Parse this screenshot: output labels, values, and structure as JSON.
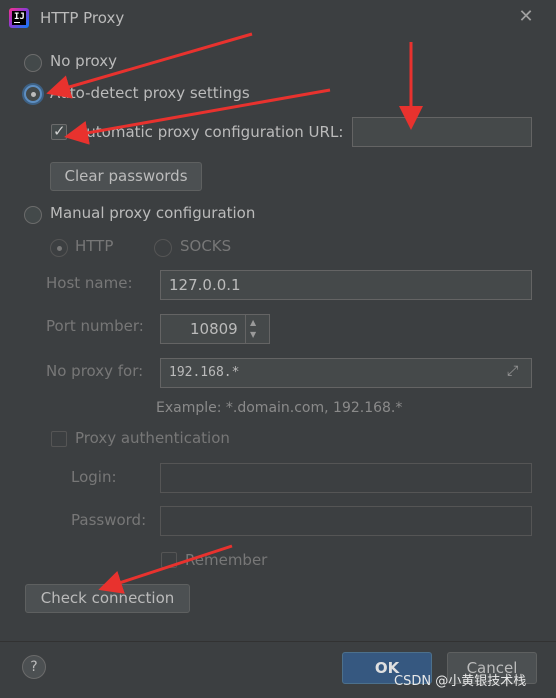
{
  "window": {
    "title": "HTTP Proxy",
    "icon": "intellij-idea-icon"
  },
  "options": {
    "no_proxy": "No proxy",
    "auto_detect": "Auto-detect proxy settings",
    "auto_config_url": "Automatic proxy configuration URL:",
    "auto_config_url_value": "",
    "clear_passwords": "Clear passwords",
    "manual": "Manual proxy configuration"
  },
  "manual": {
    "http": "HTTP",
    "socks": "SOCKS",
    "host_label": "Host name:",
    "host_value": "127.0.0.1",
    "port_label": "Port number:",
    "port_value": "10809",
    "noproxy_label": "No proxy for:",
    "noproxy_value": "192.168.*",
    "example": "Example: *.domain.com, 192.168.*",
    "auth": "Proxy authentication",
    "login_label": "Login:",
    "login_value": "",
    "password_label": "Password:",
    "password_value": "",
    "remember": "Remember"
  },
  "buttons": {
    "check_connection": "Check connection",
    "ok": "OK",
    "cancel": "Cancel",
    "help": "?"
  },
  "colors": {
    "accent": "#365880",
    "annotation_arrow": "#e8322e",
    "background": "#3c3f41"
  },
  "watermark": "CSDN @小黄银技术栈"
}
